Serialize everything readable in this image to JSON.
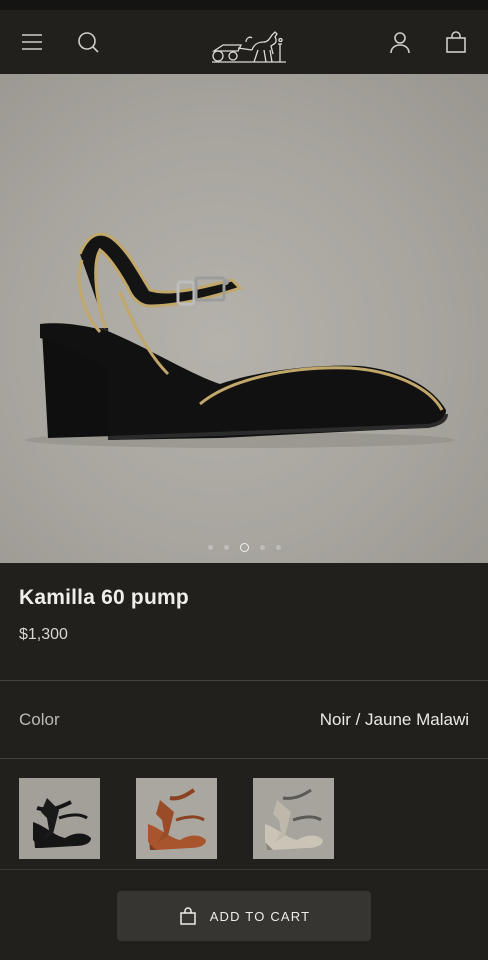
{
  "header": {
    "menu_icon": "menu-icon",
    "search_icon": "search-icon",
    "logo_icon": "carriage-logo-icon",
    "account_icon": "user-icon",
    "bag_icon": "shopping-bag-icon"
  },
  "gallery": {
    "image_count": 5,
    "active_index": 2
  },
  "product": {
    "title": "Kamilla 60 pump",
    "price": "$1,300"
  },
  "color": {
    "label": "Color",
    "selected": "Noir / Jaune Malawi",
    "selected_index": 0,
    "swatches": [
      "black",
      "brown",
      "silver"
    ]
  },
  "cart": {
    "label": "ADD TO CART",
    "icon": "shopping-bag-icon"
  },
  "colors": {
    "background": "#21201d",
    "button": "#363532",
    "divider": "#46443f"
  }
}
